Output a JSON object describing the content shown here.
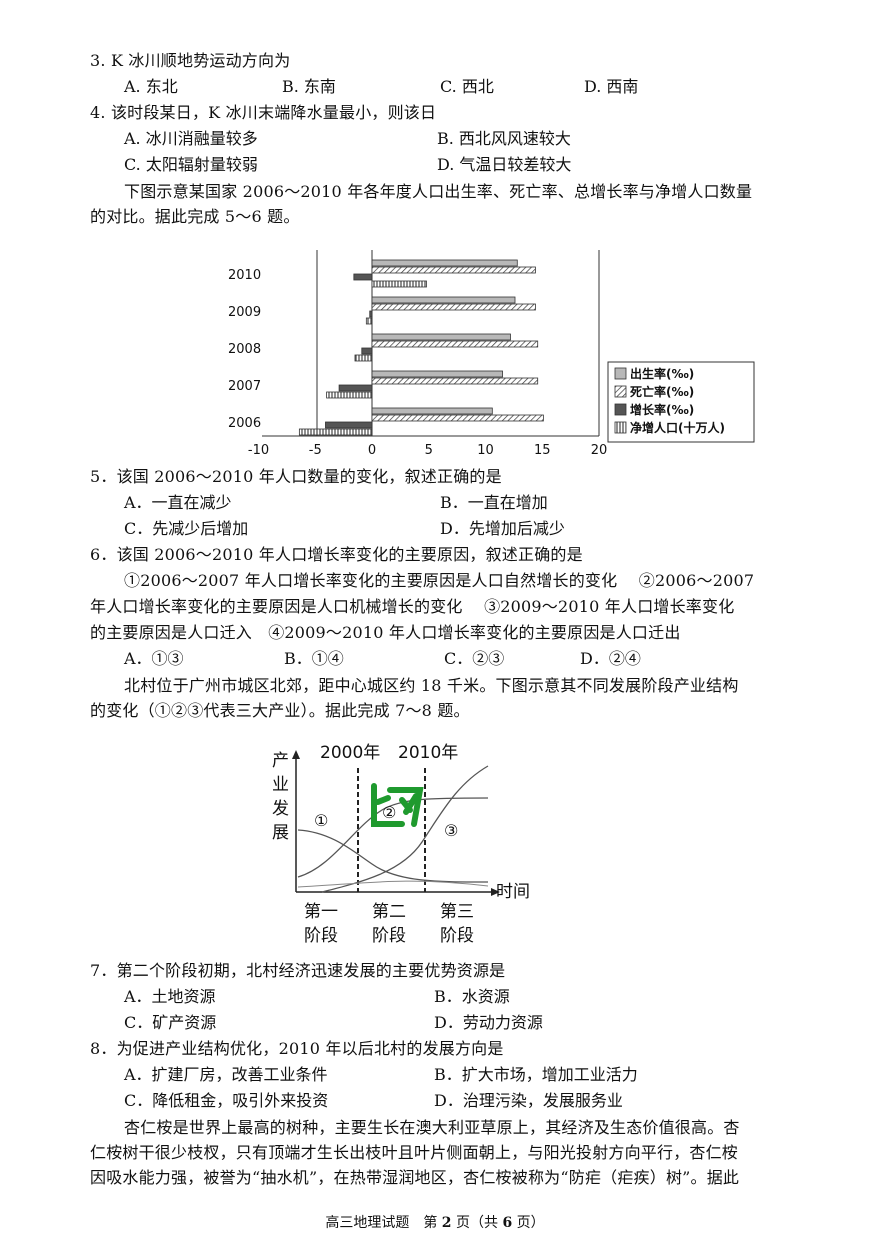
{
  "q3": {
    "stem": "3. K 冰川顺地势运动方向为",
    "options": [
      "A. 东北",
      "B. 东南",
      "C. 西北",
      "D. 西南"
    ]
  },
  "q4": {
    "stem": "4.  该时段某日，K 冰川末端降水量最小，则该日",
    "options": [
      "A. 冰川消融量较多",
      "B. 西北风风速较大",
      "C. 太阳辐射量较弱",
      "D. 气温日较差较大"
    ]
  },
  "intro56": {
    "line1": "下图示意某国家 2006～2010 年各年度人口出生率、死亡率、总增长率与净增人口数量",
    "line2": "的对比。据此完成 5～6 题。"
  },
  "chart_data": {
    "type": "bar",
    "orientation": "horizontal",
    "categories": [
      "2010",
      "2009",
      "2008",
      "2007",
      "2006"
    ],
    "series": [
      {
        "name": "出生率(‰)",
        "values": [
          12.8,
          12.6,
          12.2,
          11.5,
          10.6
        ]
      },
      {
        "name": "死亡率(‰)",
        "values": [
          14.4,
          14.4,
          14.6,
          14.6,
          15.1
        ]
      },
      {
        "name": "增长率(‰)",
        "values": [
          -1.6,
          -0.2,
          -0.9,
          -2.9,
          -4.1
        ]
      },
      {
        "name": "净增人口(十万人)",
        "values": [
          4.8,
          -0.5,
          -1.5,
          -4.0,
          -6.4
        ]
      }
    ],
    "x_ticks": [
      "-10",
      "-5",
      "0",
      "5",
      "10",
      "15",
      "20"
    ],
    "xlim": [
      -10,
      20
    ],
    "legend_position": "right",
    "colors": {
      "birth": "#b8b8b8",
      "death": "#ffffff",
      "growth": "#555555",
      "net": "#ffffff"
    }
  },
  "q5": {
    "stem": "5．该国 2006～2010 年人口数量的变化，叙述正确的是",
    "options": [
      "A．一直在减少",
      "B．一直在增加",
      "C．先减少后增加",
      "D．先增加后减少"
    ]
  },
  "q6": {
    "stem": "6．该国 2006～2010 年人口增长率变化的主要原因，叙述正确的是",
    "line1": "①2006～2007 年人口增长率变化的主要原因是人口自然增长的变化　 ②2006～2007",
    "line2": "年人口增长率变化的主要原因是人口机械增长的变化　 ③2009～2010 年人口增长率变化",
    "line3": "的主要原因是人口迁入　④2009～2010 年人口增长率变化的主要原因是人口迁出",
    "options": [
      "A．①③",
      "B．①④",
      "C．②③",
      "D．②④"
    ]
  },
  "intro78": {
    "line1": "北村位于广州市城区北郊，距中心城区约 18 千米。下图示意其不同发展阶段产业结构",
    "line2": "的变化（①②③代表三大产业）。据此完成 7～8 题。"
  },
  "diagram2": {
    "ylabel": [
      "产",
      "业",
      "发",
      "展"
    ],
    "xlabel": "时间",
    "year_labels": [
      "2000年",
      "2010年"
    ],
    "curve_labels": [
      "①",
      "②",
      "③"
    ],
    "stage_labels": [
      [
        "第一",
        "阶段"
      ],
      [
        "第二",
        "阶段"
      ],
      [
        "第三",
        "阶段"
      ]
    ],
    "watermark_color": "#1f9a2e"
  },
  "q7": {
    "stem": "7．第二个阶段初期，北村经济迅速发展的主要优势资源是",
    "options": [
      "A．土地资源",
      "B．水资源",
      "C．矿产资源",
      "D．劳动力资源"
    ]
  },
  "q8": {
    "stem": "8．为促进产业结构优化，2010 年以后北村的发展方向是",
    "options": [
      "A．扩建厂房，改善工业条件",
      "B．扩大市场，增加工业活力",
      "C．降低租金，吸引外来投资",
      "D．治理污染，发展服务业"
    ]
  },
  "intro_last": {
    "line1": "杏仁桉是世界上最高的树种，主要生长在澳大利亚草原上，其经济及生态价值很高。杏",
    "line2": "仁桉树干很少枝杈，只有顶端才生长出枝叶且叶片侧面朝上，与阳光投射方向平行，杏仁桉",
    "line3": "因吸水能力强，被誉为“抽水机”，在热带湿润地区，杏仁桉被称为“防疟（疟疾）树”。据此"
  },
  "footer": {
    "prefix": "高三地理试题　第 ",
    "page": "2",
    "mid": " 页（共 ",
    "total": "6",
    "suffix": " 页）"
  }
}
